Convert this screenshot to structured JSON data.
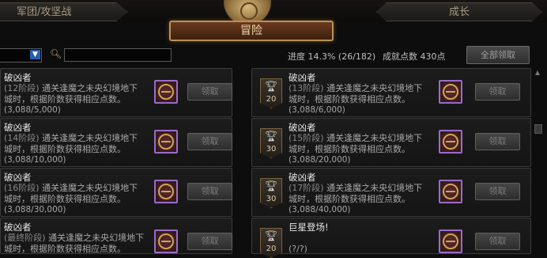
{
  "tabs": {
    "left": "军团/攻坚战",
    "active": "冒险",
    "right": "成长"
  },
  "filter": {
    "search_placeholder": "",
    "search_value": ""
  },
  "stats": {
    "progress": "进度 14.3% (26/182)",
    "score": "成就点数 430点"
  },
  "claim_all_label": "全部领取",
  "left_cards": [
    {
      "title": "破凶者",
      "stage": "(12阶段)",
      "line1": " 通关逢魔之未央幻境地下",
      "line2": "城时，根据阶数获得相应点数。",
      "progress": "(3,088/5,000)",
      "claim": "领取"
    },
    {
      "title": "破凶者",
      "stage": "(14阶段)",
      "line1": " 通关逢魔之未央幻境地下",
      "line2": "城时，根据阶数获得相应点数。",
      "progress": "(3,088/10,000)",
      "claim": "领取"
    },
    {
      "title": "破凶者",
      "stage": "(16阶段)",
      "line1": " 通关逢魔之未央幻境地下",
      "line2": "城时，根据阶数获得相应点数。",
      "progress": "(3,088/30,000)",
      "claim": "领取"
    },
    {
      "title": "破凶者",
      "stage": "(最终阶段)",
      "line1": " 通关逢魔之未央幻境地下",
      "line2": "城时，根据阶数获得相应点数。",
      "progress": "",
      "claim": "领取"
    }
  ],
  "right_cards": [
    {
      "title": "破凶者",
      "stage": "(13阶段)",
      "line1": " 通关逢魔之未央幻境地下",
      "line2": "城时，根据阶数获得相应点数。",
      "progress": "(3,088/6,000)",
      "points": "20",
      "claim": "领取"
    },
    {
      "title": "破凶者",
      "stage": "(15阶段)",
      "line1": " 通关逢魔之未央幻境地下",
      "line2": "城时，根据阶数获得相应点数。",
      "progress": "(3,088/20,000)",
      "points": "30",
      "claim": "领取"
    },
    {
      "title": "破凶者",
      "stage": "(17阶段)",
      "line1": " 通关逢魔之未央幻境地下",
      "line2": "城时，根据阶数获得相应点数。",
      "progress": "(3,088/40,000)",
      "points": "30",
      "claim": "领取"
    },
    {
      "title": "巨星登场!",
      "stage": "",
      "line1": "",
      "line2": "(?/?)",
      "progress": "",
      "points": "20",
      "claim": "领取"
    }
  ],
  "colors": {
    "accent": "#b8915a",
    "reward_border": "#9a6bc8"
  }
}
